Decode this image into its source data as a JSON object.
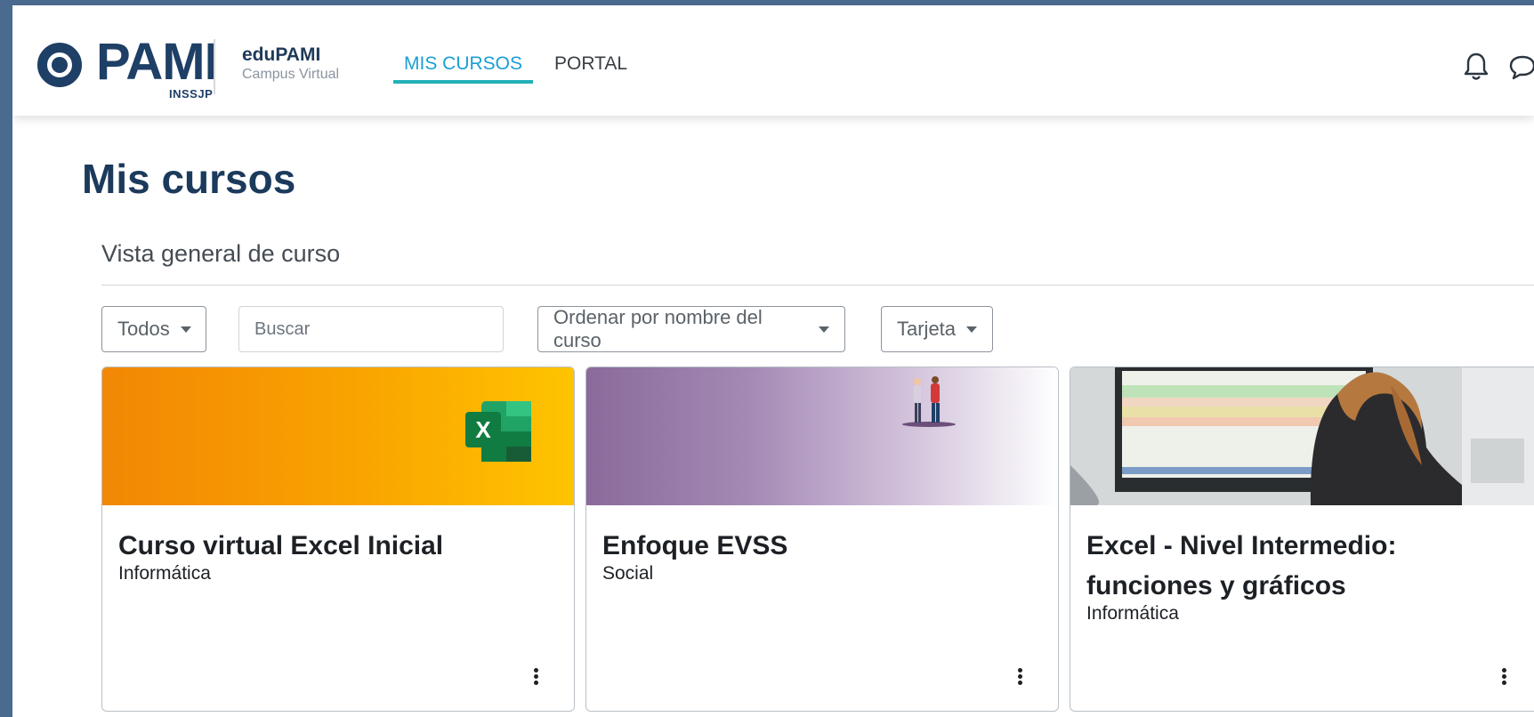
{
  "header": {
    "logo_text": "PAMI",
    "logo_sub": "INSSJP",
    "brand_name": "eduPAMI",
    "brand_sub": "Campus Virtual",
    "nav": [
      {
        "label": "MIS CURSOS",
        "active": true
      },
      {
        "label": "PORTAL",
        "active": false
      }
    ]
  },
  "main": {
    "page_title": "Mis cursos",
    "section_title": "Vista general de curso",
    "filters": {
      "status_label": "Todos",
      "search_placeholder": "Buscar",
      "sort_label": "Ordenar por nombre del curso",
      "view_label": "Tarjeta"
    },
    "courses": [
      {
        "title": "Curso virtual Excel Inicial",
        "category": "Informática"
      },
      {
        "title": "Enfoque EVSS",
        "category": "Social"
      },
      {
        "title": "Excel - Nivel Intermedio: funciones y gráficos",
        "category": "Informática"
      }
    ]
  },
  "colors": {
    "brand_dark": "#1e3f66",
    "nav_active": "#1a9fd4",
    "excel_green": "#1d6f42"
  },
  "icons": [
    "bell-icon",
    "chat-icon",
    "excel-icon",
    "card-menu-icon"
  ]
}
